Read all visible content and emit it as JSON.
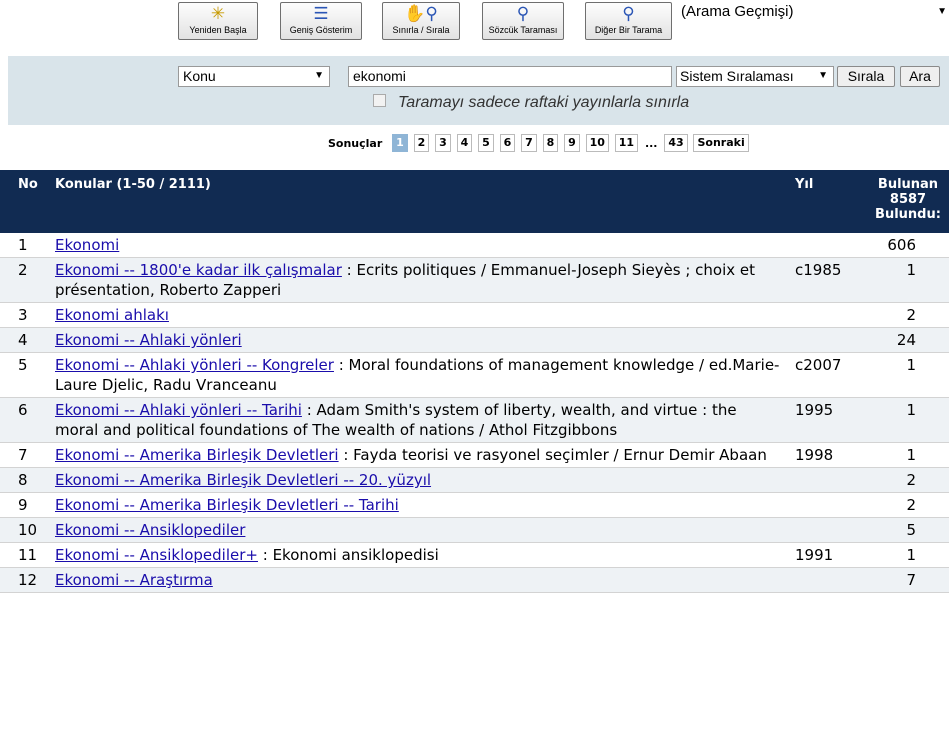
{
  "toolbar": {
    "restart": "Yeniden Başla",
    "wide_view": "Geniş Gösterim",
    "limit_sort": "Sınırla / Sırala",
    "word_search": "Sözcük Taraması",
    "other_search": "Diğer Bir Tarama",
    "history": "(Arama Geçmişi)"
  },
  "search": {
    "field": "Konu",
    "query": "ekonomi",
    "sort": "Sistem Sıralaması",
    "sort_button": "Sırala",
    "search_button": "Ara",
    "limit_label": "Taramayı sadece raftaki yayınlarla sınırla"
  },
  "pager": {
    "label": "Sonuçlar",
    "pages": [
      "1",
      "2",
      "3",
      "4",
      "5",
      "6",
      "7",
      "8",
      "9",
      "10",
      "11"
    ],
    "ellipsis": "...",
    "last": "43",
    "next": "Sonraki"
  },
  "table": {
    "col_no": "No",
    "col_subject": "Konular (1-50 / 2111)",
    "col_year": "Yıl",
    "col_count_1": "Bulunan",
    "col_count_2": "8587",
    "col_count_3": "Bulundu:",
    "rows": [
      {
        "no": "1",
        "link": "Ekonomi",
        "desc": "",
        "year": "",
        "count": "606"
      },
      {
        "no": "2",
        "link": "Ekonomi -- 1800'e kadar ilk çalışmalar",
        "desc": " : Ecrits politiques / Emmanuel-Joseph Sieyès ; choix et présentation, Roberto Zapperi",
        "year": "c1985",
        "count": "1"
      },
      {
        "no": "3",
        "link": "Ekonomi ahlakı",
        "desc": "",
        "year": "",
        "count": "2"
      },
      {
        "no": "4",
        "link": "Ekonomi -- Ahlaki yönleri",
        "desc": "",
        "year": "",
        "count": "24"
      },
      {
        "no": "5",
        "link": "Ekonomi -- Ahlaki yönleri -- Kongreler",
        "desc": " : Moral foundations of management knowledge / ed.Marie-Laure Djelic, Radu Vranceanu",
        "year": "c2007",
        "count": "1"
      },
      {
        "no": "6",
        "link": "Ekonomi -- Ahlaki yönleri -- Tarihi",
        "desc": " : Adam Smith's system of liberty, wealth, and virtue : the moral and political foundations of The wealth of nations / Athol Fitzgibbons",
        "year": "1995",
        "count": "1"
      },
      {
        "no": "7",
        "link": "Ekonomi -- Amerika Birleşik Devletleri",
        "desc": " : Fayda teorisi ve rasyonel seçimler / Ernur Demir Abaan",
        "year": "1998",
        "count": "1"
      },
      {
        "no": "8",
        "link": "Ekonomi -- Amerika Birleşik Devletleri -- 20. yüzyıl",
        "desc": "",
        "year": "",
        "count": "2"
      },
      {
        "no": "9",
        "link": "Ekonomi -- Amerika Birleşik Devletleri -- Tarihi",
        "desc": "",
        "year": "",
        "count": "2"
      },
      {
        "no": "10",
        "link": "Ekonomi -- Ansiklopediler",
        "desc": "",
        "year": "",
        "count": "5"
      },
      {
        "no": "11",
        "link": "Ekonomi -- Ansiklopediler+",
        "desc": " : Ekonomi ansiklopedisi",
        "year": "1991",
        "count": "1"
      },
      {
        "no": "12",
        "link": "Ekonomi -- Araştırma",
        "desc": "",
        "year": "",
        "count": "7"
      }
    ]
  }
}
